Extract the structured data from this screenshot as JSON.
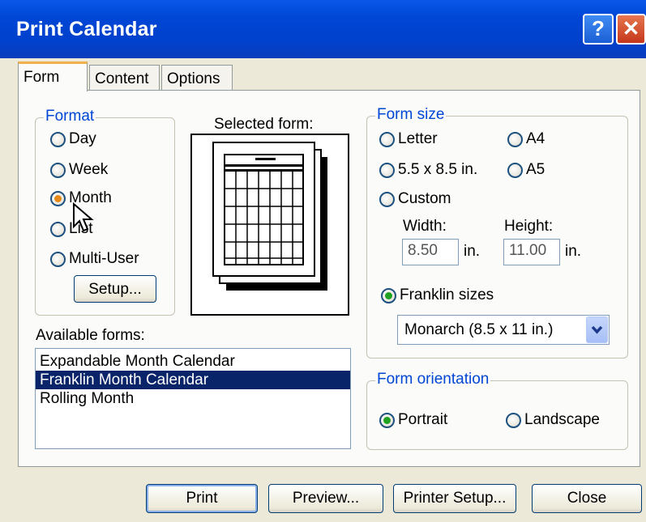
{
  "window": {
    "title": "Print Calendar",
    "help_label": "?",
    "close_label": "✕"
  },
  "tabs": [
    {
      "label": "Form",
      "active": true
    },
    {
      "label": "Content",
      "active": false
    },
    {
      "label": "Options",
      "active": false
    }
  ],
  "format": {
    "legend": "Format",
    "options": [
      {
        "label": "Day",
        "selected": false
      },
      {
        "label": "Week",
        "selected": false
      },
      {
        "label": "Month",
        "selected": true
      },
      {
        "label": "List",
        "selected": false
      },
      {
        "label": "Multi-User",
        "selected": false
      }
    ],
    "setup_label": "Setup..."
  },
  "selected_form": {
    "label": "Selected form:"
  },
  "available_forms": {
    "label": "Available forms:",
    "items": [
      {
        "label": "Expandable Month Calendar",
        "selected": false
      },
      {
        "label": "Franklin Month Calendar",
        "selected": true
      },
      {
        "label": "Rolling Month",
        "selected": false
      }
    ]
  },
  "form_size": {
    "legend": "Form size",
    "letter": "Letter",
    "a4": "A4",
    "half_letter": "5.5 x 8.5 in.",
    "a5": "A5",
    "custom": "Custom",
    "width_label": "Width:",
    "height_label": "Height:",
    "width_value": "8.50",
    "height_value": "11.00",
    "unit": "in.",
    "franklin_label": "Franklin sizes",
    "franklin_selected": true,
    "franklin_value": "Monarch  (8.5 x 11 in.)"
  },
  "orientation": {
    "legend": "Form orientation",
    "portrait": "Portrait",
    "landscape": "Landscape",
    "selected": "Portrait"
  },
  "buttons": {
    "print": "Print",
    "preview": "Preview...",
    "printer_setup": "Printer Setup...",
    "close": "Close"
  }
}
